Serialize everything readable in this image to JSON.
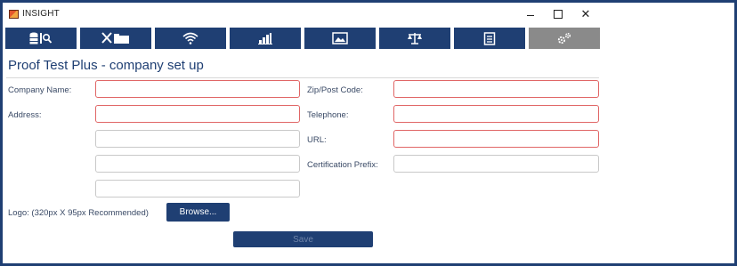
{
  "window": {
    "title": "INSIGHT",
    "controls": {
      "minimize": "–",
      "maximize": "",
      "close": "✕"
    }
  },
  "toolbar": {
    "buttons": [
      {
        "icon": "database-search-icon",
        "active": false
      },
      {
        "icon": "tools-folder-icon",
        "active": false
      },
      {
        "icon": "wifi-icon",
        "active": false
      },
      {
        "icon": "bar-chart-icon",
        "active": false
      },
      {
        "icon": "image-icon",
        "active": false
      },
      {
        "icon": "scales-icon",
        "active": false
      },
      {
        "icon": "document-icon",
        "active": false
      },
      {
        "icon": "gears-icon",
        "active": true
      }
    ],
    "colors": {
      "button_bg": "#1f3f73",
      "active_bg": "#8a8a8a"
    }
  },
  "page": {
    "title": "Proof Test Plus - company set up"
  },
  "form": {
    "company_name": {
      "label": "Company Name:",
      "value": "",
      "invalid": true
    },
    "address": {
      "label": "Address:",
      "lines": [
        {
          "value": "",
          "invalid": true
        },
        {
          "value": "",
          "invalid": false
        },
        {
          "value": "",
          "invalid": false
        },
        {
          "value": "",
          "invalid": false
        }
      ]
    },
    "zip": {
      "label": "Zip/Post Code:",
      "value": "",
      "invalid": true
    },
    "telephone": {
      "label": "Telephone:",
      "value": "",
      "invalid": true
    },
    "url": {
      "label": "URL:",
      "value": "",
      "invalid": true
    },
    "cert_prefix": {
      "label": "Certification Prefix:",
      "value": "",
      "invalid": false
    },
    "logo": {
      "label": "Logo: (320px X 95px Recommended)",
      "browse_label": "Browse..."
    },
    "save_label": "Save",
    "colors": {
      "invalid_border": "#e06666",
      "primary": "#1f3f73"
    }
  }
}
